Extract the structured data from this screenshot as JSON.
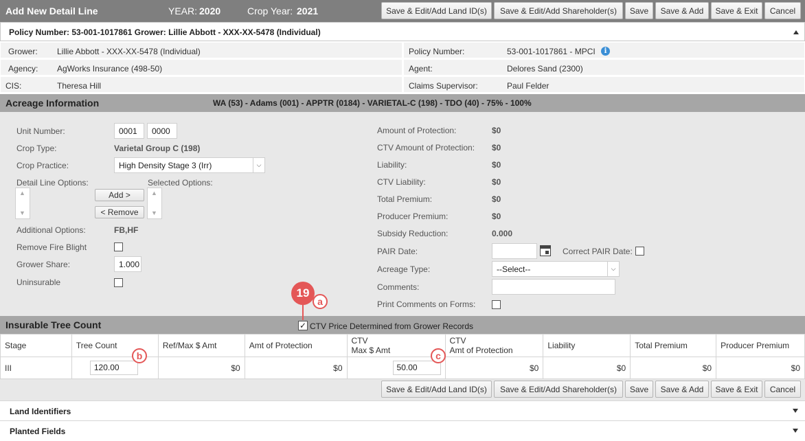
{
  "title": "Add New Detail Line",
  "year_label": "YEAR:",
  "year_value": "2020",
  "crop_year_label": "Crop Year:",
  "crop_year_value": "2021",
  "buttons": {
    "land_ids": "Save & Edit/Add Land ID(s)",
    "shareholders": "Save & Edit/Add Shareholder(s)",
    "save": "Save",
    "save_add": "Save & Add",
    "save_exit": "Save & Exit",
    "cancel": "Cancel"
  },
  "policy_header": "Policy Number: 53-001-1017861 Grower: Lillie Abbott - XXX-XX-5478 (Individual)",
  "info": {
    "grower_label": "Grower:",
    "grower_value": "Lillie Abbott - XXX-XX-5478 (Individual)",
    "agency_label": "Agency:",
    "agency_value": "AgWorks Insurance (498-50)",
    "cis_label": "CIS:",
    "cis_value": "Theresa Hill",
    "policy_label": "Policy Number:",
    "policy_value": "53-001-1017861 - MPCI",
    "agent_label": "Agent:",
    "agent_value": "Delores Sand (2300)",
    "claims_label": "Claims Supervisor:",
    "claims_value": "Paul Felder"
  },
  "acreage": {
    "heading": "Acreage Information",
    "summary": "WA (53) - Adams (001) - APPTR (0184) - VARIETAL-C (198) - TDO (40) - 75% - 100%",
    "unit_label": "Unit Number:",
    "unit_1": "0001",
    "unit_2": "0000",
    "crop_type_label": "Crop Type:",
    "crop_type_value": "Varietal Group C (198)",
    "crop_practice_label": "Crop Practice:",
    "crop_practice_value": "High Density Stage 3 (Irr)",
    "detail_options_label": "Detail Line Options:",
    "selected_options_label": "Selected Options:",
    "add_button": "Add >",
    "remove_button": "< Remove",
    "additional_options_label": "Additional Options:",
    "additional_options_value": "FB,HF",
    "remove_fire_blight_label": "Remove Fire Blight",
    "grower_share_label": "Grower Share:",
    "grower_share_value": "1.000",
    "uninsurable_label": "Uninsurable",
    "amount_protection_label": "Amount of Protection:",
    "amount_protection_value": "$0",
    "ctv_amount_protection_label": "CTV Amount of Protection:",
    "ctv_amount_protection_value": "$0",
    "liability_label": "Liability:",
    "liability_value": "$0",
    "ctv_liability_label": "CTV Liability:",
    "ctv_liability_value": "$0",
    "total_premium_label": "Total Premium:",
    "total_premium_value": "$0",
    "producer_premium_label": "Producer Premium:",
    "producer_premium_value": "$0",
    "subsidy_label": "Subsidy Reduction:",
    "subsidy_value": "0.000",
    "pair_date_label": "PAIR Date:",
    "correct_pair_label": "Correct PAIR Date:",
    "acreage_type_label": "Acreage Type:",
    "acreage_type_value": "--Select--",
    "comments_label": "Comments:",
    "print_comments_label": "Print Comments on Forms:"
  },
  "tree": {
    "heading": "Insurable Tree Count",
    "ctv_checkbox_label": "CTV Price Determined from Grower Records",
    "columns": [
      "Stage",
      "Tree Count",
      "Ref/Max $ Amt",
      "Amt of Protection",
      "CTV\nMax $ Amt",
      "CTV\nAmt of Protection",
      "Liability",
      "Total Premium",
      "Producer Premium"
    ],
    "col_ctv_max_line1": "CTV",
    "col_ctv_max_line2": "Max $ Amt",
    "col_ctv_amt_line1": "CTV",
    "col_ctv_amt_line2": "Amt of Protection",
    "row": {
      "stage": "III",
      "tree_count": "120.00",
      "ref_max": "$0",
      "amt_protection": "$0",
      "ctv_max": "50.00",
      "ctv_amt_protection": "$0",
      "liability": "$0",
      "total_premium": "$0",
      "producer_premium": "$0"
    }
  },
  "callouts": {
    "main": "19",
    "a": "a",
    "b": "b",
    "c": "c"
  },
  "sections": {
    "land_identifiers": "Land Identifiers",
    "planted_fields": "Planted Fields"
  },
  "colors": {
    "callout": "#e45757",
    "header_bar": "#7f7f7f",
    "section_bar": "#a6a6a6",
    "info_icon": "#3b8fd6"
  },
  "icons": [
    "info-icon",
    "calendar-icon",
    "chevron-up-icon",
    "chevron-down-icon",
    "select-arrow-icon",
    "check-icon"
  ]
}
